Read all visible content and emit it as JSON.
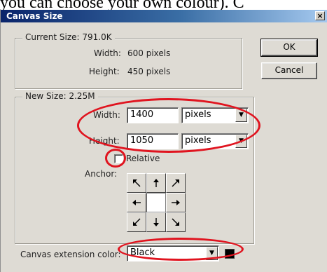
{
  "background_caption": "you can choose your own colour). C",
  "dialog": {
    "title": "Canvas Size",
    "close_glyph": "×",
    "current_size": {
      "title": "Current Size: 791.0K",
      "width_label": "Width:",
      "width_value": "600 pixels",
      "height_label": "Height:",
      "height_value": "450 pixels"
    },
    "new_size": {
      "title": "New Size: 2.25M",
      "width_label": "Width:",
      "width_value": "1400",
      "width_unit": "pixels",
      "height_label": "Height:",
      "height_value": "1050",
      "height_unit": "pixels",
      "relative_label": "Relative",
      "relative_checked": false,
      "anchor_label": "Anchor:",
      "anchor_icons": [
        "arrow-nw-icon",
        "arrow-n-icon",
        "arrow-ne-icon",
        "arrow-w-icon",
        "",
        "arrow-e-icon",
        "arrow-sw-icon",
        "arrow-s-icon",
        "arrow-se-icon"
      ]
    },
    "extension": {
      "label": "Canvas extension color:",
      "value": "Black",
      "swatch_color": "#000000"
    },
    "buttons": {
      "ok": "OK",
      "cancel": "Cancel"
    },
    "highlight_color": "#e0141f"
  }
}
